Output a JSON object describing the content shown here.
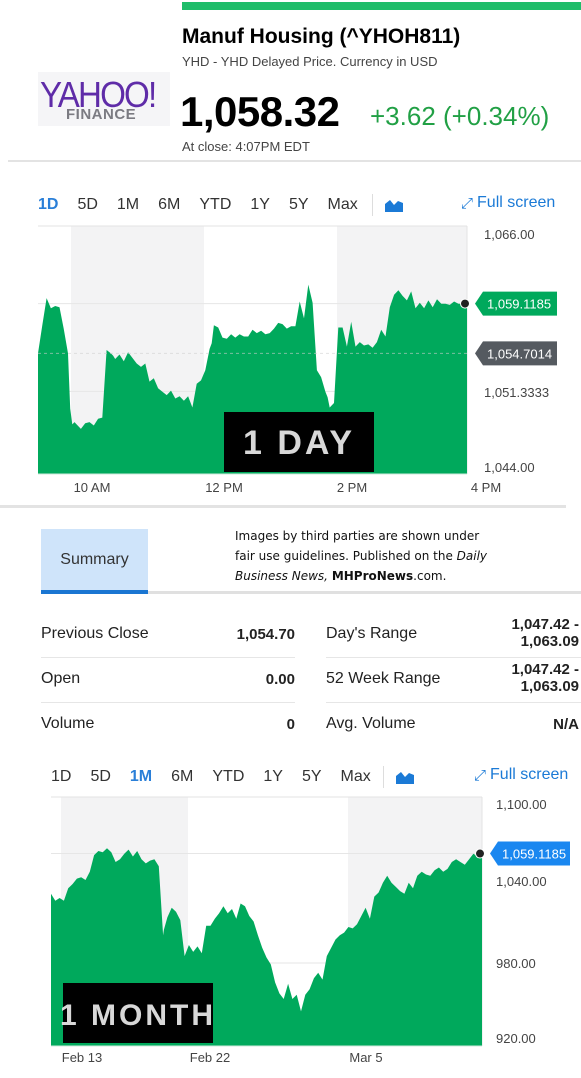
{
  "header": {
    "logo_main": "YAHOO!",
    "logo_sub": "FINANCE",
    "title": "Manuf Housing (^YHOH811)",
    "subtitle": "YHD - YHD Delayed Price. Currency in USD",
    "price": "1,058.32",
    "change": "+3.62 (+0.34%)",
    "close_time": "At close: 4:07PM EDT",
    "accent_color": "#1fbd6a",
    "change_color": "#21a045"
  },
  "range_bar_1": {
    "options": [
      "1D",
      "5D",
      "1M",
      "6M",
      "YTD",
      "1Y",
      "5Y",
      "Max"
    ],
    "active": "1D",
    "chart_type_icon": "area-chart-icon",
    "fullscreen_label": "Full screen"
  },
  "range_bar_2": {
    "options": [
      "1D",
      "5D",
      "1M",
      "6M",
      "YTD",
      "1Y",
      "5Y",
      "Max"
    ],
    "active": "1M",
    "chart_type_icon": "area-chart-icon",
    "fullscreen_label": "Full screen"
  },
  "summary": {
    "tab_label": "Summary",
    "credit_line1": "Images by third parties are shown under",
    "credit_line2a": "fair use guidelines.  Published on the ",
    "credit_line2b": "Daily",
    "credit_line3a": "Business News,",
    "credit_line3b": "MHProNews",
    "credit_line3c": ".com.",
    "left": [
      {
        "label": "Previous Close",
        "value": "1,054.70"
      },
      {
        "label": "Open",
        "value": "0.00"
      },
      {
        "label": "Volume",
        "value": "0"
      }
    ],
    "right": [
      {
        "label": "Day's Range",
        "value_line1": "1,047.42 -",
        "value_line2": "1,063.09"
      },
      {
        "label": "52 Week Range",
        "value_line1": "1,047.42 -",
        "value_line2": "1,063.09"
      },
      {
        "label": "Avg. Volume",
        "value_line1": "N/A",
        "value_line2": ""
      }
    ]
  },
  "chart_data": [
    {
      "type": "area",
      "title": "",
      "overlay_label": "1 DAY",
      "xlabel": "",
      "ylabel": "",
      "x_ticks": [
        "10 AM",
        "12 PM",
        "2 PM",
        "4 PM"
      ],
      "y_ticks": [
        "1,066.00",
        "1,051.3333",
        "1,044.00"
      ],
      "ylim": [
        1044,
        1066
      ],
      "current_value_label": "1,059.1185",
      "previous_close_label": "1,054.7014",
      "current_value": 1059.1185,
      "previous_close": 1054.7014,
      "color": "#00a95c",
      "current_badge_color": "#00a95c",
      "prev_badge_color": "#555a60",
      "x_range": [
        0,
        1
      ],
      "x": [
        0.0,
        0.01,
        0.02,
        0.03,
        0.04,
        0.05,
        0.06,
        0.07,
        0.075,
        0.08,
        0.085,
        0.09,
        0.1,
        0.11,
        0.12,
        0.13,
        0.14,
        0.15,
        0.16,
        0.17,
        0.175,
        0.18,
        0.19,
        0.2,
        0.21,
        0.22,
        0.23,
        0.24,
        0.25,
        0.26,
        0.27,
        0.28,
        0.29,
        0.3,
        0.31,
        0.32,
        0.33,
        0.34,
        0.35,
        0.36,
        0.37,
        0.38,
        0.39,
        0.4,
        0.405,
        0.41,
        0.42,
        0.43,
        0.44,
        0.45,
        0.46,
        0.47,
        0.48,
        0.49,
        0.5,
        0.51,
        0.52,
        0.53,
        0.54,
        0.55,
        0.56,
        0.57,
        0.58,
        0.59,
        0.6,
        0.61,
        0.62,
        0.63,
        0.64,
        0.65,
        0.66,
        0.67,
        0.675,
        0.68,
        0.69,
        0.7,
        0.71,
        0.72,
        0.73,
        0.74,
        0.75,
        0.76,
        0.77,
        0.78,
        0.79,
        0.8,
        0.81,
        0.82,
        0.83,
        0.84,
        0.85,
        0.86,
        0.87,
        0.88,
        0.89,
        0.9,
        0.91,
        0.92,
        0.93,
        0.94,
        0.95,
        0.96,
        0.97,
        0.98,
        0.99,
        1.0
      ],
      "values": [
        1054.7,
        1057.2,
        1059.6,
        1058.7,
        1058.9,
        1058.8,
        1056.9,
        1054.7,
        1049.8,
        1048.4,
        1048.6,
        1048.4,
        1048.0,
        1048.5,
        1048.6,
        1048.3,
        1048.9,
        1049.0,
        1055.0,
        1054.7,
        1054.5,
        1054.2,
        1054.6,
        1054.0,
        1054.8,
        1054.3,
        1053.8,
        1053.5,
        1053.8,
        1052.2,
        1052.5,
        1051.6,
        1051.3,
        1051.0,
        1051.4,
        1050.7,
        1050.9,
        1050.5,
        1050.9,
        1049.9,
        1052.0,
        1052.3,
        1053.2,
        1055.1,
        1055.6,
        1057.2,
        1057.0,
        1056.1,
        1056.0,
        1056.4,
        1056.1,
        1056.4,
        1056.2,
        1056.2,
        1056.8,
        1056.5,
        1056.7,
        1056.4,
        1056.5,
        1056.9,
        1057.4,
        1057.3,
        1056.9,
        1057.1,
        1057.1,
        1059.3,
        1057.8,
        1060.8,
        1059.2,
        1053.2,
        1052.6,
        1051.3,
        1050.8,
        1049.9,
        1050.3,
        1057.0,
        1057.0,
        1055.3,
        1057.5,
        1055.3,
        1055.7,
        1055.4,
        1055.5,
        1055.2,
        1055.7,
        1056.8,
        1056.2,
        1058.8,
        1059.9,
        1060.3,
        1059.8,
        1059.4,
        1060.2,
        1058.7,
        1059.2,
        1058.7,
        1059.4,
        1058.8,
        1059.5,
        1059.1,
        1059.1,
        1059.0,
        1059.3,
        1059.1,
        1059.1,
        1059.1
      ]
    },
    {
      "type": "area",
      "title": "",
      "overlay_label": "1 MONTH",
      "xlabel": "",
      "ylabel": "",
      "x_ticks": [
        "Feb 13",
        "Feb 22",
        "Mar 5"
      ],
      "y_ticks": [
        "1,100.00",
        "1,040.00",
        "980.00",
        "920.00"
      ],
      "ylim": [
        920,
        1100
      ],
      "current_value_label": "1,059.1185",
      "current_value": 1059.1185,
      "color": "#00a95c",
      "current_badge_color": "#1a87f0",
      "x_range": [
        0,
        1
      ],
      "x": [
        0.0,
        0.01,
        0.02,
        0.03,
        0.04,
        0.05,
        0.06,
        0.07,
        0.08,
        0.09,
        0.1,
        0.11,
        0.12,
        0.13,
        0.14,
        0.15,
        0.16,
        0.17,
        0.18,
        0.19,
        0.2,
        0.21,
        0.22,
        0.23,
        0.24,
        0.25,
        0.26,
        0.262,
        0.27,
        0.28,
        0.29,
        0.3,
        0.31,
        0.32,
        0.33,
        0.34,
        0.35,
        0.36,
        0.37,
        0.38,
        0.39,
        0.4,
        0.41,
        0.42,
        0.43,
        0.44,
        0.45,
        0.46,
        0.47,
        0.48,
        0.49,
        0.5,
        0.51,
        0.52,
        0.53,
        0.54,
        0.55,
        0.56,
        0.57,
        0.58,
        0.59,
        0.6,
        0.61,
        0.62,
        0.63,
        0.64,
        0.65,
        0.66,
        0.67,
        0.68,
        0.69,
        0.7,
        0.71,
        0.72,
        0.73,
        0.74,
        0.75,
        0.76,
        0.77,
        0.78,
        0.79,
        0.8,
        0.81,
        0.82,
        0.83,
        0.84,
        0.85,
        0.86,
        0.87,
        0.88,
        0.89,
        0.9,
        0.91,
        0.92,
        0.93,
        0.94,
        0.95,
        0.96,
        0.97,
        0.98,
        0.99,
        1.0
      ],
      "values": [
        1030,
        1025,
        1027,
        1025,
        1034,
        1037,
        1041,
        1042,
        1040,
        1046,
        1058,
        1061,
        1060,
        1063,
        1060,
        1053,
        1055,
        1059,
        1062,
        1057,
        1061,
        1055,
        1052,
        1054,
        1055,
        1050,
        1000,
        1004,
        1013,
        1020,
        1017,
        1011,
        985,
        993,
        988,
        992,
        987,
        1007,
        1007,
        1012,
        1016,
        1021,
        1016,
        1019,
        1012,
        1023,
        1021,
        1014,
        1010,
        1000,
        991,
        984,
        979,
        966,
        958,
        954,
        965,
        954,
        957,
        945,
        957,
        961,
        969,
        973,
        968,
        985,
        991,
        997,
        1000,
        1002,
        1006,
        1005,
        1008,
        1014,
        1020,
        1012,
        1028,
        1031,
        1038,
        1043,
        1038,
        1035,
        1032,
        1030,
        1038,
        1034,
        1043,
        1046,
        1044,
        1043,
        1047,
        1049,
        1046,
        1048,
        1053,
        1055,
        1053,
        1051,
        1055,
        1059,
        1057,
        1059
      ]
    }
  ]
}
